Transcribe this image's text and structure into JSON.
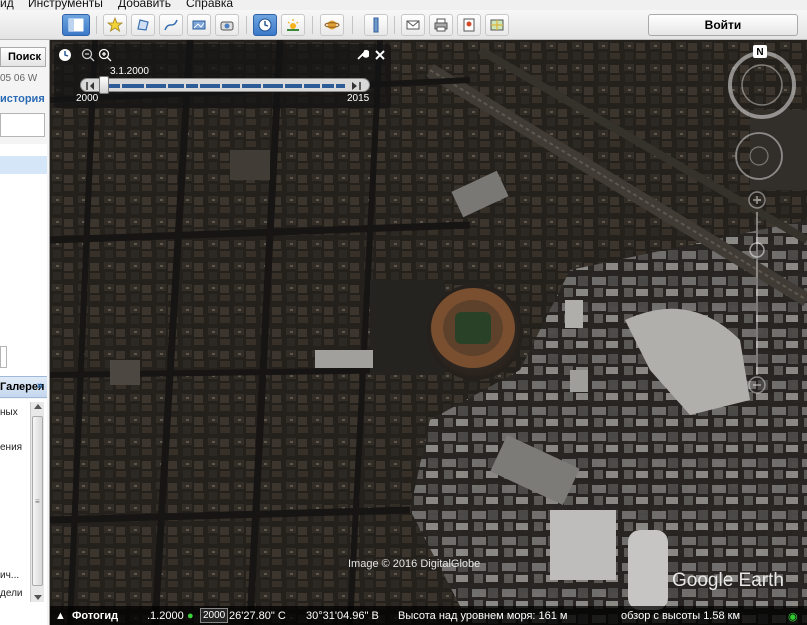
{
  "menu": {
    "items": [
      "ид",
      "Инструменты",
      "Добавить",
      "Справка"
    ]
  },
  "toolbar": {
    "login_label": "Войти"
  },
  "sidebar": {
    "search_label": "Поиск",
    "coords_snippet": "05 06 W",
    "history_label": "история",
    "gallery_label": "Галерея",
    "gallery_arrow": "»",
    "list_items": [
      "ных",
      "ения",
      "ич...",
      "дели"
    ]
  },
  "timeline": {
    "current_date": "3.1.2000",
    "start_year": "2000",
    "end_year": "2015"
  },
  "status": {
    "tour_label": "Фотогид",
    "date_box_left": ".1.2000",
    "date_box_right": "2000",
    "latitude": "26'27.80\" С",
    "longitude": "30°31'04.96\" В",
    "elevation": "Высота над уровнем моря:   161 м",
    "eye_alt": "обзор с высоты   1.58 км"
  },
  "credit": "Image © 2016 DigitalGlobe",
  "brand": "Google Earth",
  "colors": {
    "accent": "#2a6bb5",
    "map_dark": "#1c1a17",
    "stadium_field": "#2f4a2c",
    "stadium_track": "#8a5a36"
  }
}
